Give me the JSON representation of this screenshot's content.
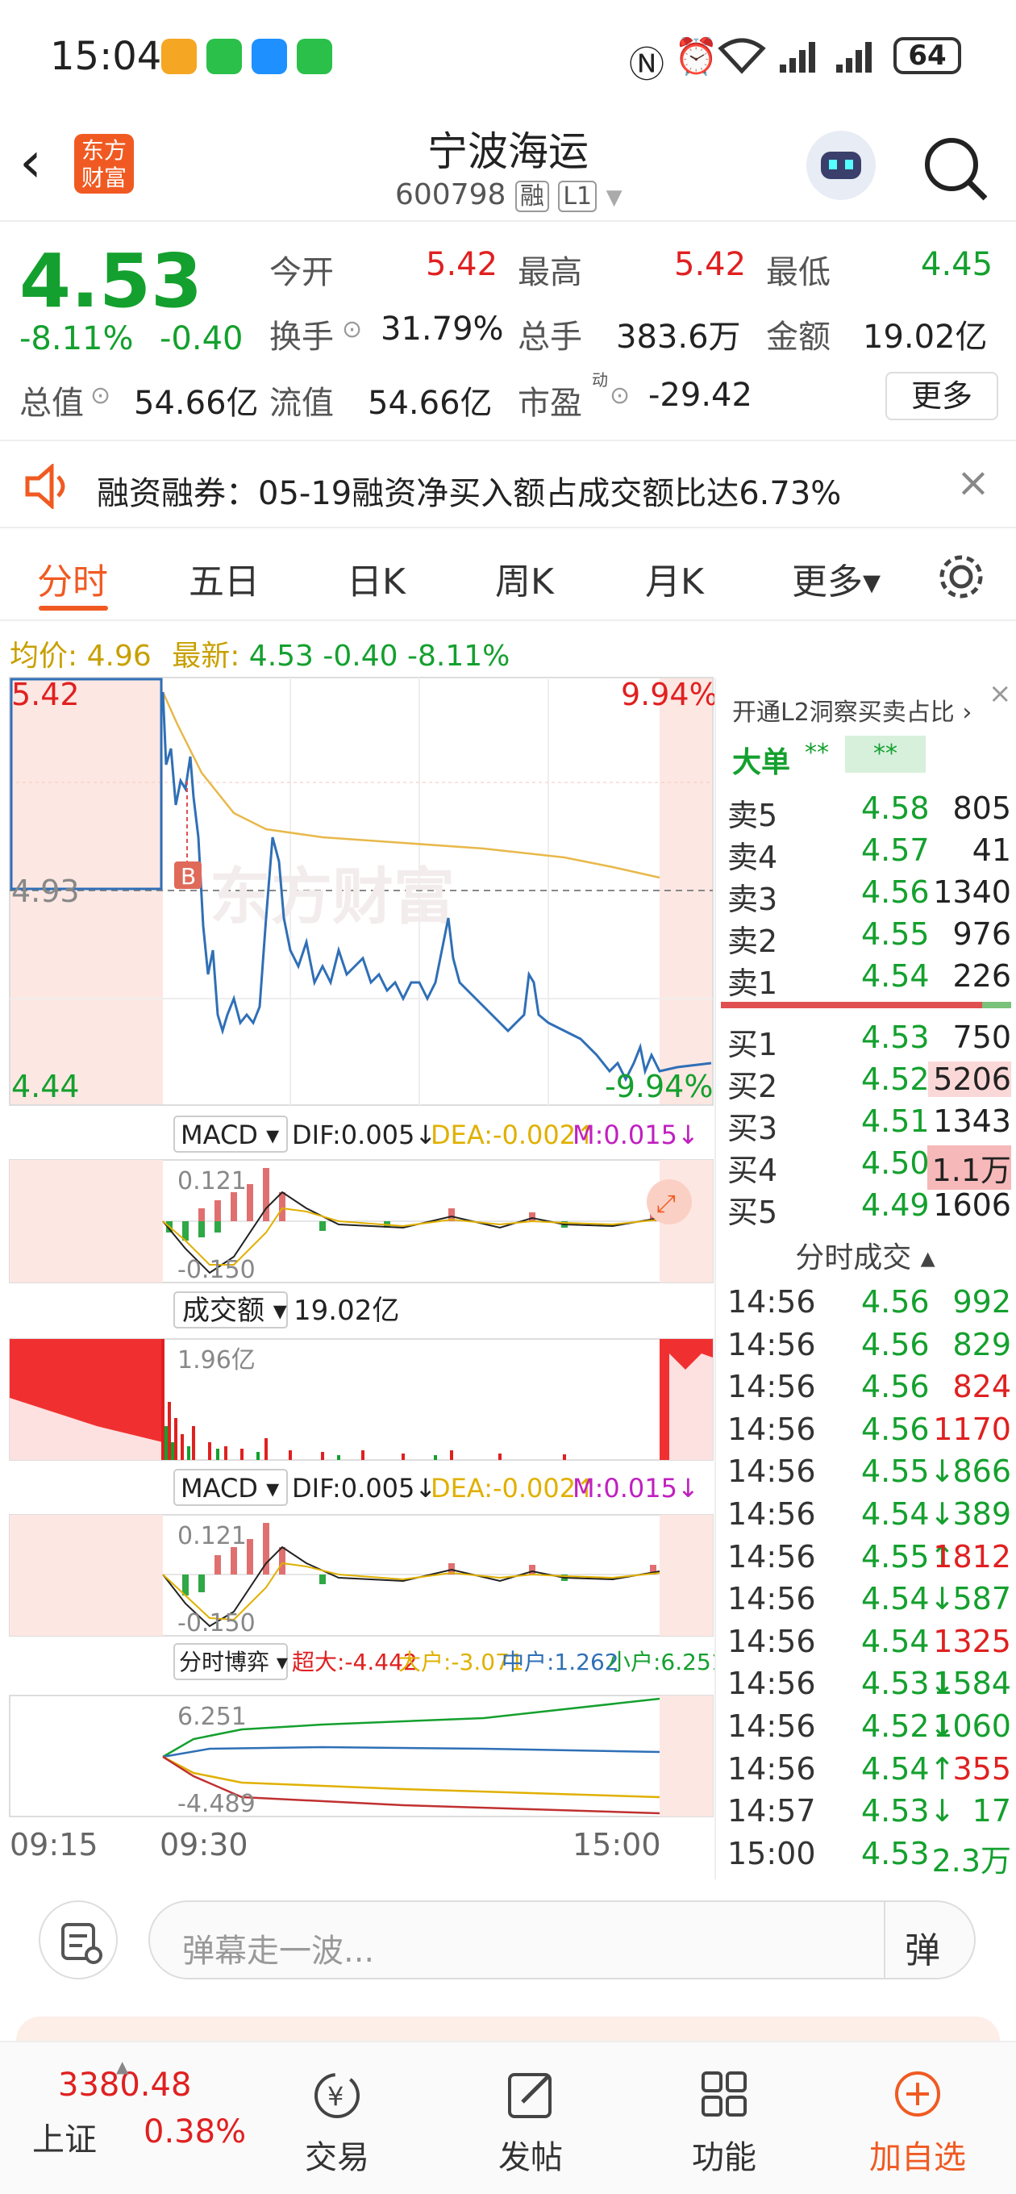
{
  "status": {
    "time": "15:04",
    "battery": "64"
  },
  "header": {
    "title": "宁波海运",
    "code": "600798",
    "badge1": "融",
    "badge2": "L1",
    "logo_line1": "东方",
    "logo_line2": "财富"
  },
  "quote": {
    "price": "4.53",
    "pct": "-8.11%",
    "chg": "-0.40",
    "open_label": "今开",
    "open": "5.42",
    "high_label": "最高",
    "high": "5.42",
    "low_label": "最低",
    "low": "4.45",
    "turnover_label": "换手",
    "turnover": "31.79%",
    "volume_label": "总手",
    "volume": "383.6万",
    "amount_label": "金额",
    "amount": "19.02亿",
    "mcap_label": "总值",
    "mcap": "54.66亿",
    "float_label": "流值",
    "float": "54.66亿",
    "pe_label": "市盈",
    "pe_sup": "动",
    "pe": "-29.42",
    "more": "更多"
  },
  "notice": {
    "text": "融资融券：05-19融资净买入额占成交额比达6.73%"
  },
  "tabs": [
    "分时",
    "五日",
    "日K",
    "周K",
    "月K",
    "更多▾"
  ],
  "chartinfo": {
    "avg_label": "均价:",
    "avg": "4.96",
    "latest_label": "最新:",
    "latest": "4.53",
    "chg": "-0.40",
    "pct": "-8.11%"
  },
  "chart": {
    "ymax": "5.42",
    "ymid": "4.93",
    "ymin": "4.44",
    "pmax": "9.94%",
    "pmin": "-9.94%",
    "marker": "B",
    "watermark": "东方财富",
    "macd_label": "MACD ▾",
    "dif": "DIF:0.005↓",
    "dea": "DEA:-0.002↑",
    "m": "M:0.015↓",
    "macd_hi": "0.121",
    "macd_lo": "-0.150",
    "amt_label": "成交额 ▾",
    "amt": "19.02亿",
    "amt_hi": "1.96亿",
    "game_label": "分时博弈 ▾",
    "cd": "超大:-4.442",
    "dh": "大户:-3.071",
    "zh": "中户:1.262",
    "xh": "小户:6.251",
    "game_hi": "6.251",
    "game_lo": "-4.489",
    "t1": "09:15",
    "t2": "09:30",
    "t3": "15:00"
  },
  "orderbook": {
    "banner": "开通L2洞察买卖占比 ›",
    "big_label": "大单",
    "big_a": "**",
    "big_b": "**",
    "sells": [
      {
        "l": "卖5",
        "p": "4.58",
        "v": "805"
      },
      {
        "l": "卖4",
        "p": "4.57",
        "v": "41"
      },
      {
        "l": "卖3",
        "p": "4.56",
        "v": "1340"
      },
      {
        "l": "卖2",
        "p": "4.55",
        "v": "976"
      },
      {
        "l": "卖1",
        "p": "4.54",
        "v": "226"
      }
    ],
    "buys": [
      {
        "l": "买1",
        "p": "4.53",
        "v": "750"
      },
      {
        "l": "买2",
        "p": "4.52",
        "v": "5206"
      },
      {
        "l": "买3",
        "p": "4.51",
        "v": "1343"
      },
      {
        "l": "买4",
        "p": "4.50",
        "v": "1.1万"
      },
      {
        "l": "买5",
        "p": "4.49",
        "v": "1606"
      }
    ],
    "ticks_title": "分时成交 ▴",
    "ticks": [
      {
        "t": "14:56",
        "p": "4.56",
        "v": "992",
        "c": "green"
      },
      {
        "t": "14:56",
        "p": "4.56",
        "v": "829",
        "c": "green"
      },
      {
        "t": "14:56",
        "p": "4.56",
        "v": "824",
        "c": "red"
      },
      {
        "t": "14:56",
        "p": "4.56",
        "v": "1170",
        "c": "red"
      },
      {
        "t": "14:56",
        "p": "4.55↓",
        "v": "866",
        "c": "green"
      },
      {
        "t": "14:56",
        "p": "4.54↓",
        "v": "389",
        "c": "green"
      },
      {
        "t": "14:56",
        "p": "4.55↑",
        "v": "1812",
        "c": "red"
      },
      {
        "t": "14:56",
        "p": "4.54↓",
        "v": "587",
        "c": "green"
      },
      {
        "t": "14:56",
        "p": "4.54",
        "v": "1325",
        "c": "red"
      },
      {
        "t": "14:56",
        "p": "4.53↓",
        "v": "1584",
        "c": "green"
      },
      {
        "t": "14:56",
        "p": "4.52↓",
        "v": "1060",
        "c": "green"
      },
      {
        "t": "14:56",
        "p": "4.54↑",
        "v": "355",
        "c": "red"
      },
      {
        "t": "14:57",
        "p": "4.53↓",
        "v": "17",
        "c": "green"
      },
      {
        "t": "15:00",
        "p": "4.53",
        "v": "2.3万",
        "c": "green"
      }
    ]
  },
  "comment": {
    "placeholder": "弹幕走一波...",
    "btn": "弹"
  },
  "nav": {
    "index_val": "3380.48",
    "index_name": "上证",
    "index_pct": "0.38%",
    "items": [
      "交易",
      "发帖",
      "功能",
      "加自选"
    ]
  }
}
